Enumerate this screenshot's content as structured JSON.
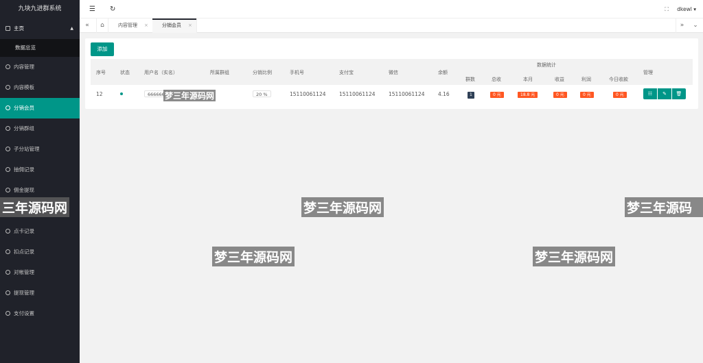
{
  "app_title": "九块九进群系统",
  "sidebar": {
    "home_label": "主页",
    "home_sub": "数据总览",
    "items": [
      {
        "label": "内容管理"
      },
      {
        "label": "内容模板"
      },
      {
        "label": "分销会员"
      },
      {
        "label": "分销群组"
      },
      {
        "label": "子分站管理"
      },
      {
        "label": "抽佣记录"
      },
      {
        "label": "佣金提现"
      },
      {
        "label": ""
      },
      {
        "label": "点卡记录"
      },
      {
        "label": "扣点记录"
      },
      {
        "label": "对帐管理"
      },
      {
        "label": "提现管理"
      },
      {
        "label": "支付设置"
      }
    ]
  },
  "header": {
    "menu_icon": "☰",
    "refresh_icon": "↻",
    "fullscreen_icon": "⛶",
    "username": "dkewl",
    "user_caret": "▾"
  },
  "tabs": {
    "prev_icon": "«",
    "home_icon": "⌂",
    "next_icon": "»",
    "more_icon": "⌄",
    "items": [
      {
        "label": "内容管理",
        "close": "×"
      },
      {
        "label": "分销会员",
        "close": "×"
      }
    ]
  },
  "toolbar": {
    "add_label": "添加"
  },
  "table": {
    "headers": {
      "index": "序号",
      "status": "状态",
      "username": "用户名（实名）",
      "group": "所属群组",
      "ratio": "分销比例",
      "phone": "手机号",
      "alipay": "支付宝",
      "wechat": "微信",
      "balance": "余额",
      "stats_group": "数据统计",
      "group_count": "群数",
      "total": "总收",
      "month": "本月",
      "income": "收益",
      "profit": "利润",
      "today": "今日收款",
      "manage": "管理"
    },
    "row": {
      "index": "12",
      "username": "666666",
      "ratio": "20 %",
      "phone": "15110061124",
      "alipay": "15110061124",
      "wechat": "15110061124",
      "balance": "4.16",
      "group_count": "1",
      "total": "0 元",
      "month": "18.8 元",
      "income": "0 元",
      "profit": "0 元",
      "today": "0 元"
    },
    "actions": {
      "view": "☷",
      "edit": "✎",
      "delete": "🗑"
    }
  },
  "watermark": "梦三年源码网",
  "watermark_left": "三年源码网",
  "watermark_right": "梦三年源码"
}
